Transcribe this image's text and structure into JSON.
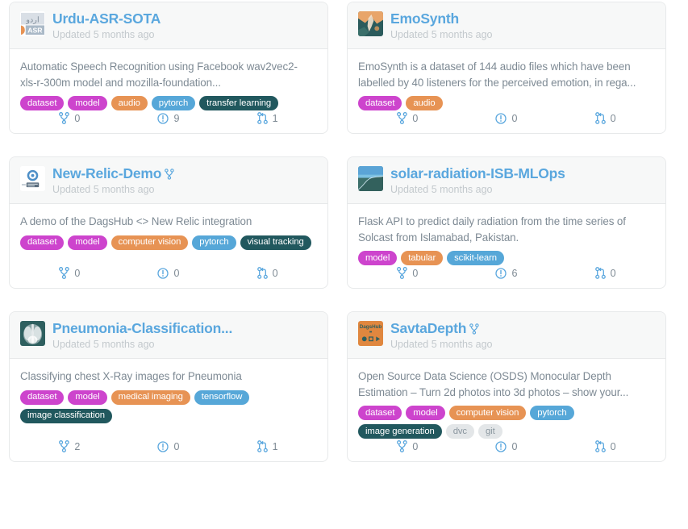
{
  "page": {
    "kind": "repository-card-grid",
    "columns": 2,
    "accent_color": "#5aa7de",
    "card_header_bg": "#f7f8f8",
    "card_border_color": "#e7e9ea"
  },
  "tag_colors": {
    "dataset": "#cd44cd",
    "model": "#cd44cd",
    "audio": "#e79354",
    "computer vision": "#e79354",
    "medical imaging": "#e79354",
    "tabular": "#e79354",
    "pytorch": "#56a7d8",
    "tensorflow": "#56a7d8",
    "scikit-learn": "#56a7d8",
    "transfer learning": "#21585e",
    "visual tracking": "#21585e",
    "image classification": "#21585e",
    "image generation": "#21585e",
    "dvc": "#e3e6e8",
    "git": "#e3e6e8"
  },
  "stat_labels": {
    "branches": "branches",
    "issues": "issues",
    "pull_requests": "pull requests"
  },
  "repos": [
    {
      "title": "Urdu-ASR-SOTA",
      "updated": "Updated 5 months ago",
      "is_fork": false,
      "avatar": "urdu-asr-logo",
      "description": "Automatic Speech Recognition using Facebook wav2vec2-xls-r-300m model and mozilla-foundation...",
      "tags": [
        {
          "label": "dataset",
          "style": "t-purple"
        },
        {
          "label": "model",
          "style": "t-purple"
        },
        {
          "label": "audio",
          "style": "t-orange"
        },
        {
          "label": "pytorch",
          "style": "t-blue"
        },
        {
          "label": "transfer learning",
          "style": "t-teal"
        }
      ],
      "stats": {
        "branches": "0",
        "issues": "9",
        "pull_requests": "1"
      }
    },
    {
      "title": "EmoSynth",
      "updated": "Updated 5 months ago",
      "is_fork": false,
      "avatar": "emosynth-photo",
      "description": "EmoSynth is a dataset of 144 audio files which have been labelled by 40 listeners for the perceived emotion, in rega...",
      "tags": [
        {
          "label": "dataset",
          "style": "t-purple"
        },
        {
          "label": "audio",
          "style": "t-orange"
        }
      ],
      "stats": {
        "branches": "0",
        "issues": "0",
        "pull_requests": "0"
      }
    },
    {
      "title": "New-Relic-Demo",
      "updated": "Updated 5 months ago",
      "is_fork": true,
      "avatar": "new-relic-logo",
      "description": "A demo of the DagsHub <> New Relic integration",
      "tags": [
        {
          "label": "dataset",
          "style": "t-purple"
        },
        {
          "label": "model",
          "style": "t-purple"
        },
        {
          "label": "computer vision",
          "style": "t-orange"
        },
        {
          "label": "pytorch",
          "style": "t-blue"
        },
        {
          "label": "visual tracking",
          "style": "t-teal"
        }
      ],
      "stats": {
        "branches": "0",
        "issues": "0",
        "pull_requests": "0"
      }
    },
    {
      "title": "solar-radiation-ISB-MLOps",
      "updated": "Updated 5 months ago",
      "is_fork": false,
      "avatar": "solar-chart-photo",
      "description": "Flask API to predict daily radiation from the time series of Solcast from Islamabad, Pakistan.",
      "tags": [
        {
          "label": "model",
          "style": "t-purple"
        },
        {
          "label": "tabular",
          "style": "t-orange"
        },
        {
          "label": "scikit-learn",
          "style": "t-blue"
        }
      ],
      "stats": {
        "branches": "0",
        "issues": "6",
        "pull_requests": "0"
      }
    },
    {
      "title": "Pneumonia-Classification...",
      "updated": "Updated 5 months ago",
      "is_fork": false,
      "avatar": "xray-photo",
      "description": "Classifying chest X-Ray images for Pneumonia",
      "tags": [
        {
          "label": "dataset",
          "style": "t-purple"
        },
        {
          "label": "model",
          "style": "t-purple"
        },
        {
          "label": "medical imaging",
          "style": "t-orange"
        },
        {
          "label": "tensorflow",
          "style": "t-blue"
        },
        {
          "label": "image classification",
          "style": "t-teal"
        }
      ],
      "stats": {
        "branches": "2",
        "issues": "0",
        "pull_requests": "1"
      }
    },
    {
      "title": "SavtaDepth",
      "updated": "Updated 5 months ago",
      "is_fork": true,
      "avatar": "dagshub-logo",
      "description": "Open Source Data Science (OSDS) Monocular Depth Estimation – Turn 2d photos into 3d photos – show your...",
      "tags": [
        {
          "label": "dataset",
          "style": "t-purple"
        },
        {
          "label": "model",
          "style": "t-purple"
        },
        {
          "label": "computer vision",
          "style": "t-orange"
        },
        {
          "label": "pytorch",
          "style": "t-blue"
        },
        {
          "label": "image generation",
          "style": "t-teal"
        },
        {
          "label": "dvc",
          "style": "t-gray"
        },
        {
          "label": "git",
          "style": "t-gray"
        }
      ],
      "stats": {
        "branches": "0",
        "issues": "0",
        "pull_requests": "0"
      }
    }
  ]
}
